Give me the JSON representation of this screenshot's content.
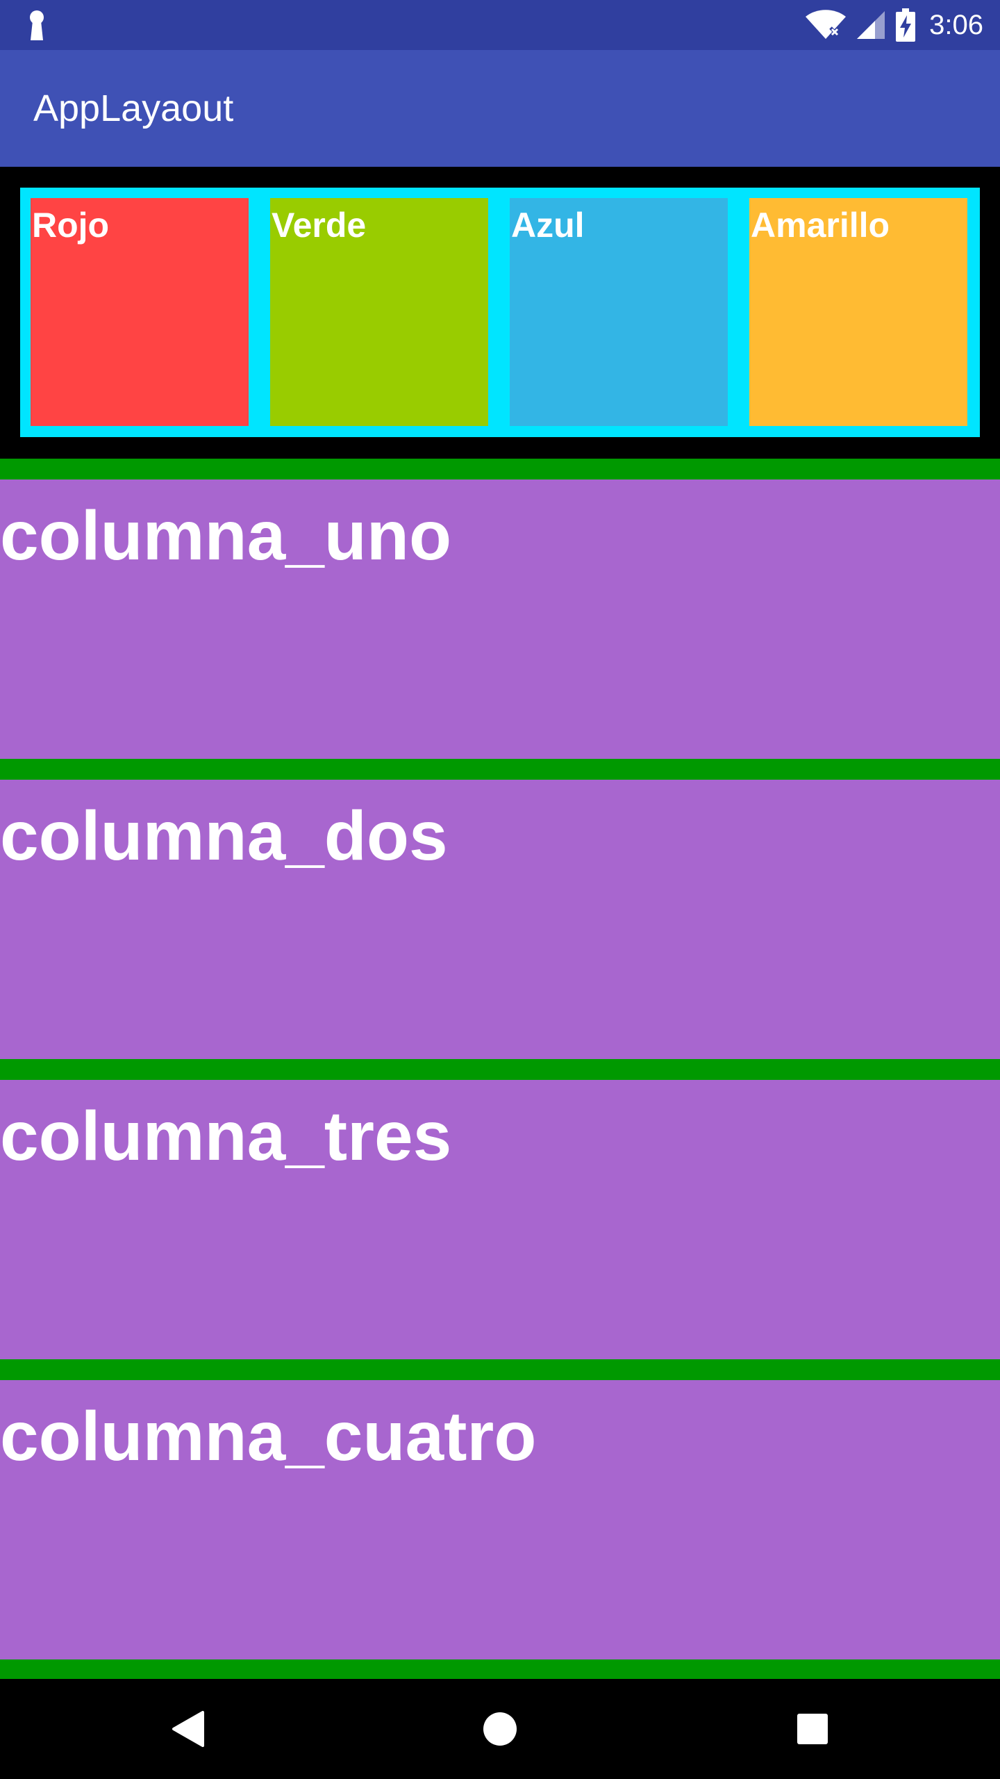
{
  "status_bar": {
    "time": "3:06",
    "icons": [
      "keyhole-icon",
      "wifi-off-icon",
      "cell-signal-icon",
      "battery-charging-icon"
    ],
    "color": "#303F9F"
  },
  "app_bar": {
    "title": "AppLayaout",
    "color": "#3F51B5"
  },
  "color_row": {
    "frame_color": "#00E5FF",
    "items": [
      {
        "label": "Rojo",
        "color": "#FF4444"
      },
      {
        "label": "Verde",
        "color": "#99CC00"
      },
      {
        "label": "Azul",
        "color": "#33B5E5"
      },
      {
        "label": "Amarillo",
        "color": "#FFBB33"
      }
    ]
  },
  "columns": {
    "block_color": "#A866CF",
    "divider_color": "#009900",
    "items": [
      {
        "label": "columna_uno"
      },
      {
        "label": "columna_dos"
      },
      {
        "label": "columna_tres"
      },
      {
        "label": "columna_cuatro"
      }
    ]
  },
  "nav_bar": {
    "icons": [
      "back-icon",
      "home-icon",
      "recents-icon"
    ]
  }
}
